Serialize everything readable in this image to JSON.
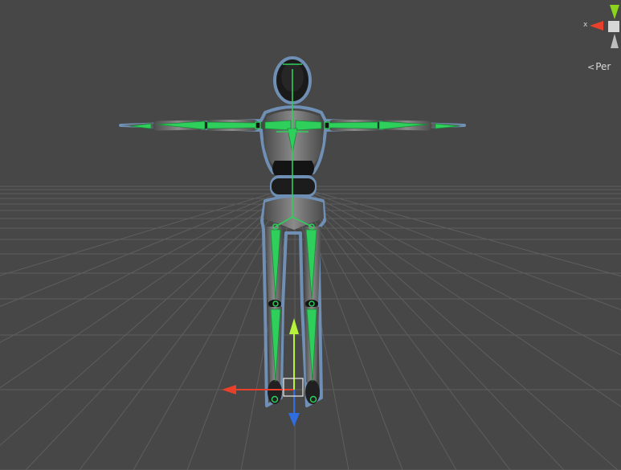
{
  "viewport": {
    "background": "#474747",
    "grid_color": "#5e5e5e"
  },
  "gizmo": {
    "x_axis_label": "x",
    "projection_label": "Per",
    "x_color": "#e8402a",
    "y_color": "#8ad41c",
    "z_color": "#2f6de0"
  },
  "character": {
    "bone_color": "#2ecf5a",
    "selection_outline_color": "#6f8fb4",
    "body_color": "#7b7b7b",
    "joint_color": "#141414"
  },
  "move_tool": {
    "x_color": "#e8402a",
    "y_color": "#b6f23a",
    "z_color": "#2f6de0",
    "center_box_icon": "square-outline-icon"
  }
}
